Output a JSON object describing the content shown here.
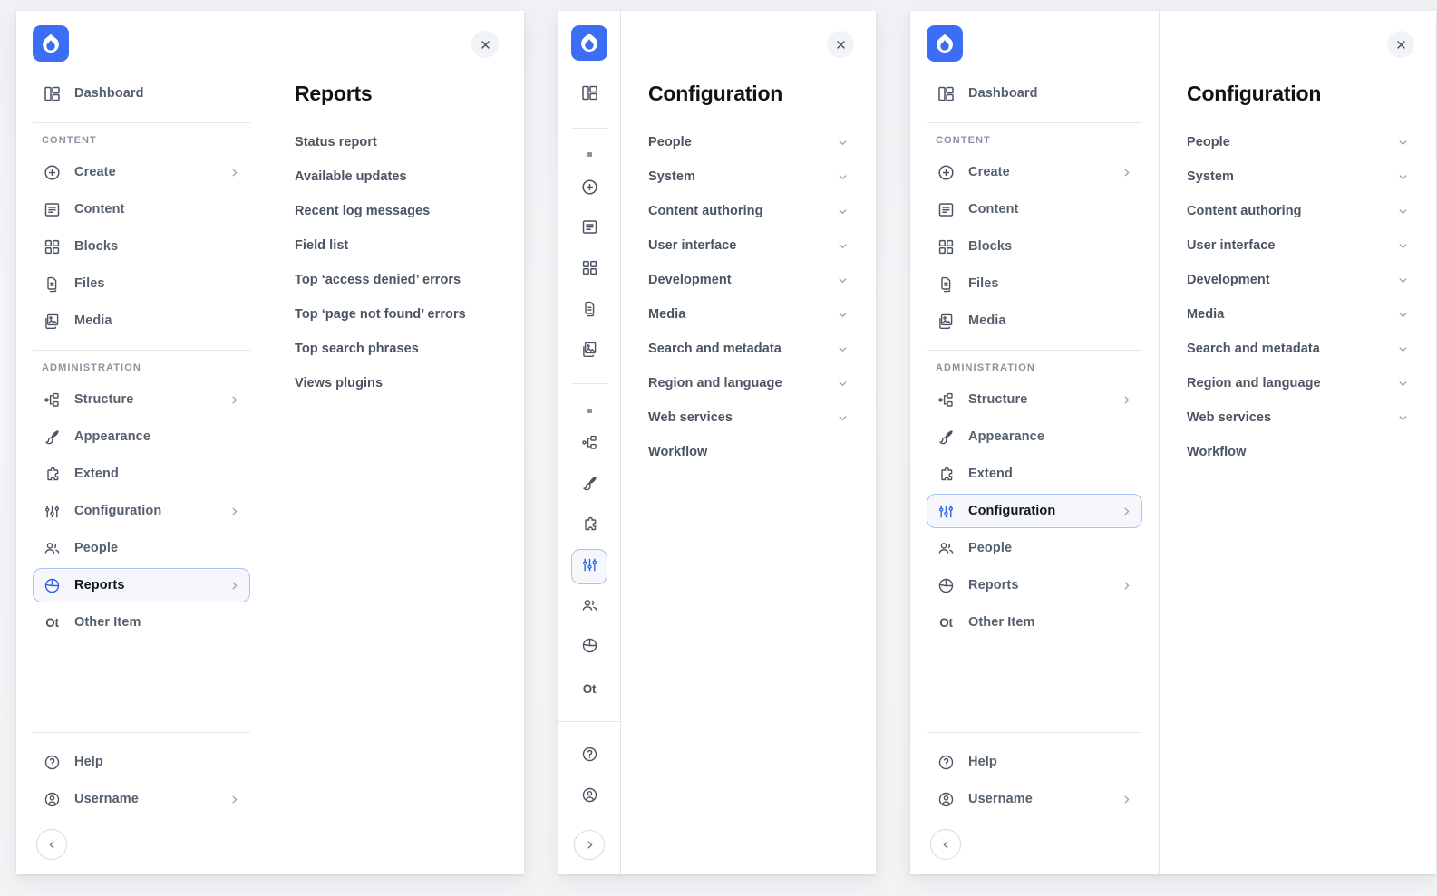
{
  "brand": {
    "logo_icon": "drupal-drop-icon",
    "accent": "#3b6ef5",
    "active_border": "#a8c2f7",
    "active_bg": "#f5f7fb"
  },
  "sidebar": {
    "dashboard": {
      "label": "Dashboard",
      "icon": "dashboard-icon"
    },
    "section_content": "CONTENT",
    "section_administration": "ADMINISTRATION",
    "content_items": [
      {
        "label": "Create",
        "icon": "plus-circle-icon",
        "chevron": true
      },
      {
        "label": "Content",
        "icon": "content-list-icon",
        "chevron": false
      },
      {
        "label": "Blocks",
        "icon": "blocks-grid-icon",
        "chevron": false
      },
      {
        "label": "Files",
        "icon": "files-icon",
        "chevron": false
      },
      {
        "label": "Media",
        "icon": "media-image-icon",
        "chevron": false
      }
    ],
    "admin_items": [
      {
        "label": "Structure",
        "icon": "structure-icon",
        "chevron": true
      },
      {
        "label": "Appearance",
        "icon": "paintbrush-icon",
        "chevron": false
      },
      {
        "label": "Extend",
        "icon": "puzzle-piece-icon",
        "chevron": false
      },
      {
        "label": "Configuration",
        "icon": "sliders-icon",
        "chevron": true
      },
      {
        "label": "People",
        "icon": "people-icon",
        "chevron": false
      },
      {
        "label": "Reports",
        "icon": "pie-chart-icon",
        "chevron": true
      },
      {
        "label": "Other Item",
        "icon": "Ot",
        "chevron": false,
        "text_icon": true
      }
    ],
    "footer_items": [
      {
        "label": "Help",
        "icon": "help-circle-icon",
        "chevron": false
      },
      {
        "label": "Username",
        "icon": "user-circle-icon",
        "chevron": true
      }
    ],
    "collapse_button": {
      "icon": "chevron-left-icon"
    },
    "expand_button": {
      "icon": "chevron-right-icon"
    }
  },
  "panels": {
    "reports": {
      "title": "Reports",
      "close_icon": "close-icon",
      "items": [
        {
          "label": "Status report"
        },
        {
          "label": "Available updates"
        },
        {
          "label": "Recent log messages"
        },
        {
          "label": "Field list"
        },
        {
          "label": "Top ‘access denied’ errors"
        },
        {
          "label": "Top ‘page not found’ errors"
        },
        {
          "label": "Top search phrases"
        },
        {
          "label": "Views plugins"
        }
      ]
    },
    "configuration": {
      "title": "Configuration",
      "close_icon": "close-icon",
      "items": [
        {
          "label": "People",
          "chevron": true
        },
        {
          "label": "System",
          "chevron": true
        },
        {
          "label": "Content authoring",
          "chevron": true
        },
        {
          "label": "User interface",
          "chevron": true
        },
        {
          "label": "Development",
          "chevron": true
        },
        {
          "label": "Media",
          "chevron": true
        },
        {
          "label": "Search and metadata",
          "chevron": true
        },
        {
          "label": "Region and language",
          "chevron": true
        },
        {
          "label": "Web services",
          "chevron": true
        },
        {
          "label": "Workflow",
          "chevron": false
        }
      ]
    }
  },
  "states": {
    "group1_active": "Reports",
    "group2_active": "Configuration",
    "group3_active": "Configuration"
  }
}
